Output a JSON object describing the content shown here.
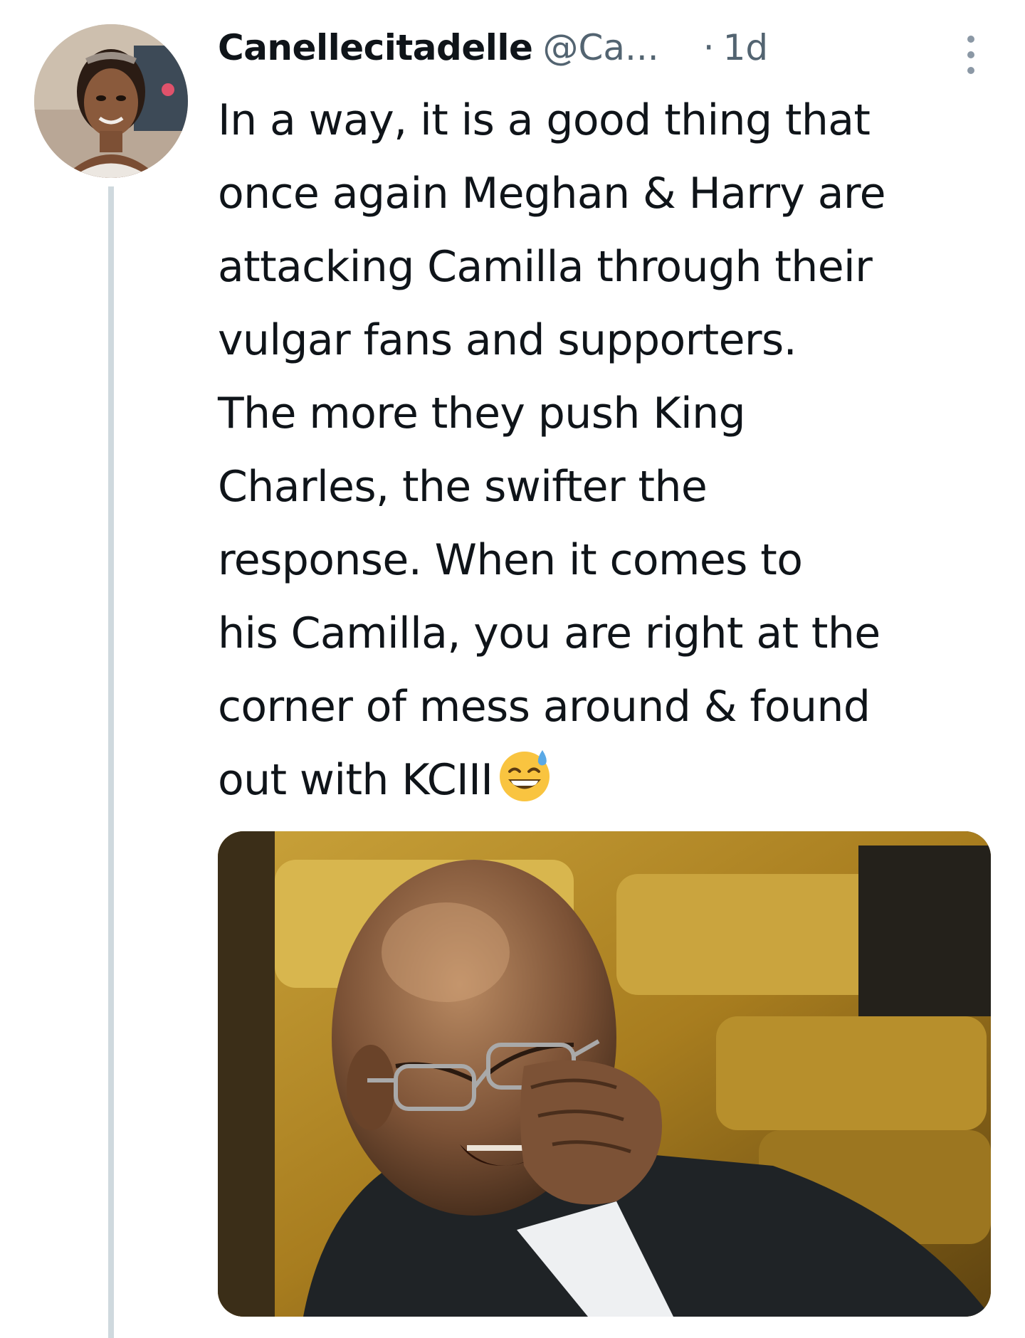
{
  "tweet": {
    "display_name": "Canellecitadelle",
    "handle": "@Ca...",
    "separator": "·",
    "time": "1d",
    "text_lines": [
      "In a way, it is a good thing that",
      "once again Meghan & Harry are",
      "attacking Camilla through their",
      "vulgar fans and supporters.",
      "The more they push King",
      "Charles, the swifter the",
      "response. When it comes to",
      "his Camilla, you are right at the",
      "corner of mess around & found",
      "out with KCIII"
    ],
    "emoji": "grinning-face-with-sweat-icon"
  },
  "icons": {
    "avatar": "profile-photo",
    "more": "more-options-icon"
  },
  "colors": {
    "text_primary": "#0f1419",
    "text_secondary": "#536471",
    "thread_line": "#cfd9de",
    "emoji_yellow": "#f9c440",
    "sweat_blue": "#5aa9e6"
  },
  "media": {
    "kind": "photo",
    "subject": "laughing-man-photo"
  }
}
